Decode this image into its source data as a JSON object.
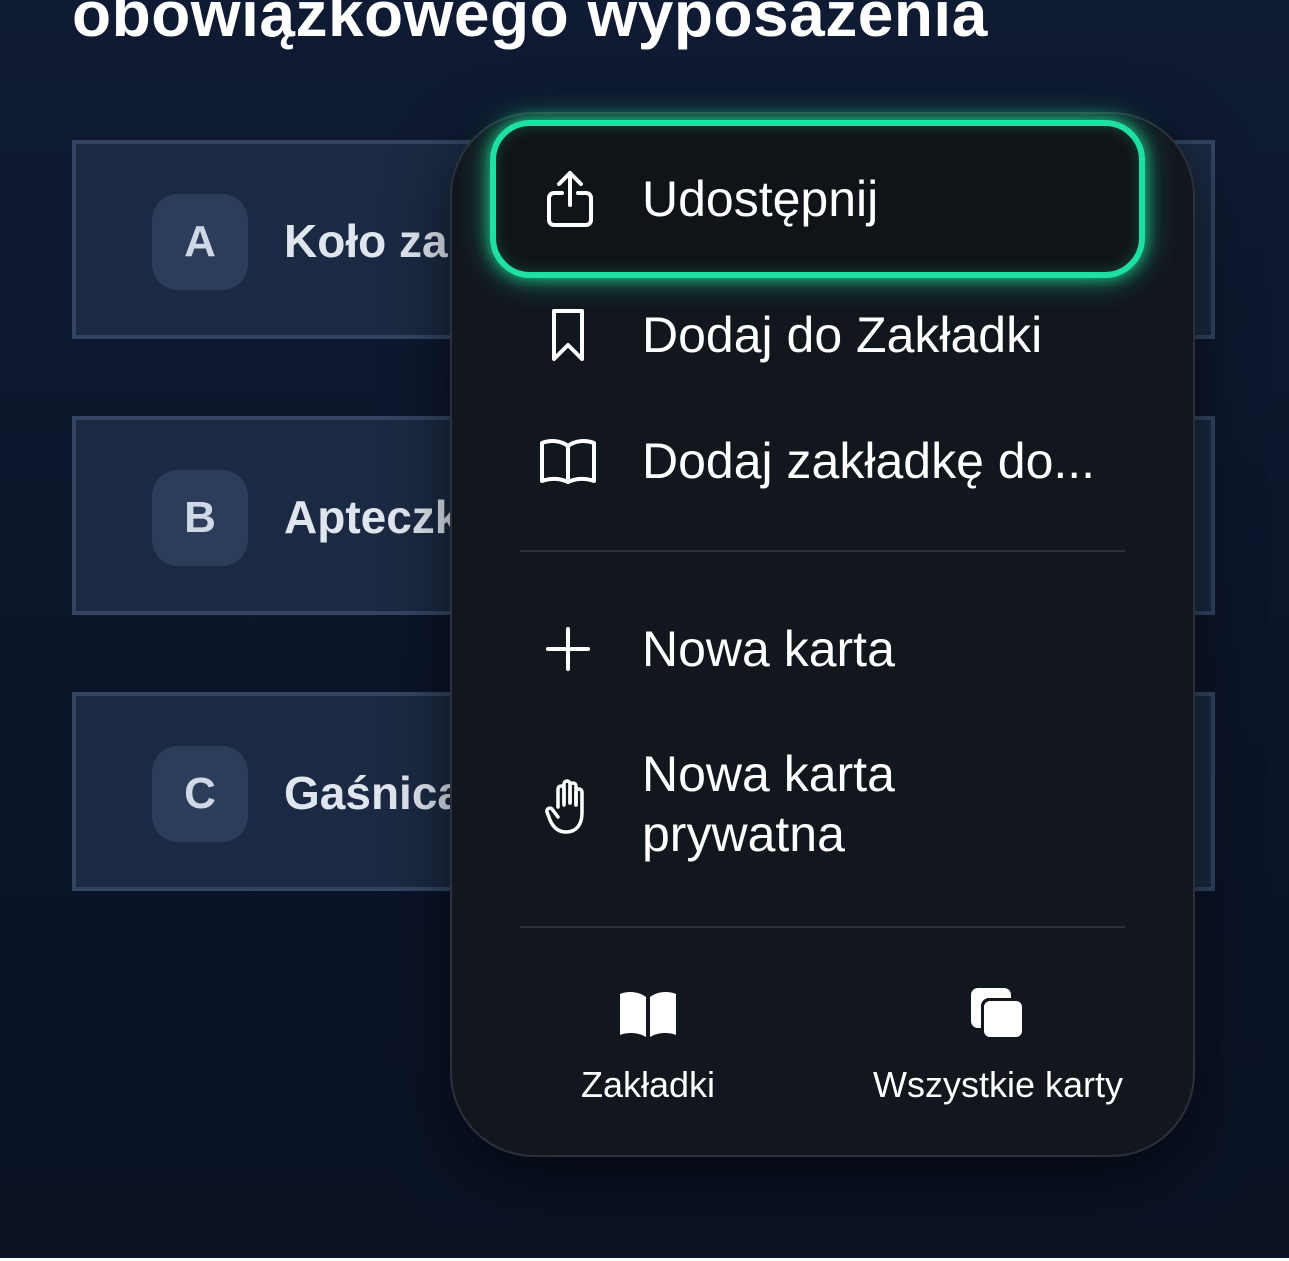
{
  "page": {
    "title": "obowiązkowego wyposażenia"
  },
  "answers": [
    {
      "letter": "A",
      "text": "Koło za"
    },
    {
      "letter": "B",
      "text": "Apteczk"
    },
    {
      "letter": "C",
      "text": "Gaśnica"
    }
  ],
  "menu": {
    "share_label": "Udostępnij",
    "add_bookmark_label": "Dodaj do Zakładki",
    "add_bookmark_to_label": "Dodaj zakładkę do...",
    "new_tab_label": "Nowa karta",
    "new_private_tab_line1": "Nowa karta",
    "new_private_tab_line2": "prywatna",
    "bookmarks_label": "Zakładki",
    "all_tabs_label": "Wszystkie karty"
  },
  "icons": {
    "share": "share-icon",
    "bookmark": "bookmark-icon",
    "book": "book-open-icon",
    "plus": "plus-icon",
    "hand": "hand-icon",
    "bookmarks": "book-filled-icon",
    "tabs": "tabs-icon"
  },
  "colors": {
    "highlight": "#1fe0a0",
    "menu_bg": "#12161d",
    "page_bg": "#0b1428"
  }
}
